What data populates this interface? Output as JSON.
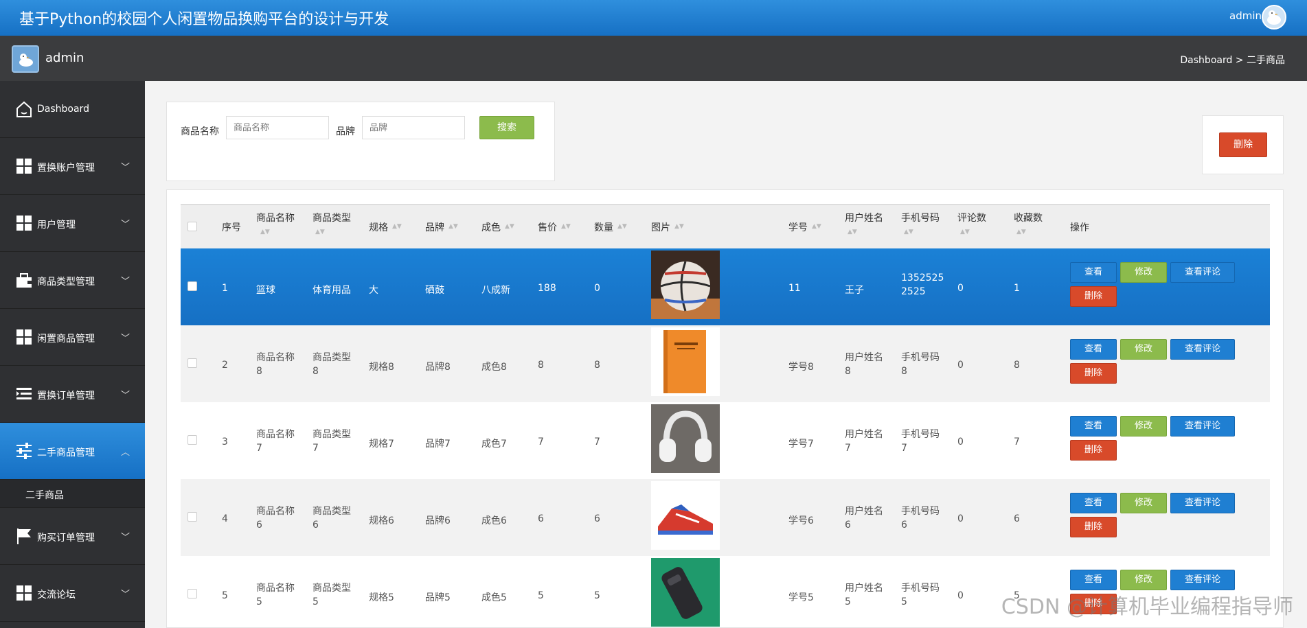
{
  "header": {
    "title": "基于Python的校园个人闲置物品换购平台的设计与开发",
    "user": "admin"
  },
  "subheader": {
    "name": "admin",
    "breadcrumb": "Dashboard > 二手商品"
  },
  "sidebar": {
    "items": [
      {
        "label": "Dashboard",
        "icon": "home-icon"
      },
      {
        "label": "置换账户管理",
        "icon": "grid-icon"
      },
      {
        "label": "用户管理",
        "icon": "grid-icon"
      },
      {
        "label": "商品类型管理",
        "icon": "briefcase-icon"
      },
      {
        "label": "闲置商品管理",
        "icon": "grid-icon"
      },
      {
        "label": "置换订单管理",
        "icon": "list-icon"
      },
      {
        "label": "二手商品管理",
        "icon": "sliders-icon"
      },
      {
        "label": "购买订单管理",
        "icon": "flag-icon"
      },
      {
        "label": "交流论坛",
        "icon": "grid-icon"
      }
    ],
    "submenu": "二手商品"
  },
  "search": {
    "name_label": "商品名称",
    "name_placeholder": "商品名称",
    "brand_label": "品牌",
    "brand_placeholder": "品牌",
    "button": "搜索"
  },
  "actions": {
    "delete": "删除"
  },
  "table": {
    "headers": [
      "序号",
      "商品名称",
      "商品类型",
      "规格",
      "品牌",
      "成色",
      "售价",
      "数量",
      "图片",
      "学号",
      "用户姓名",
      "手机号码",
      "评论数",
      "收藏数",
      "操作"
    ],
    "row_buttons": {
      "view": "查看",
      "edit": "修改",
      "reviews": "查看评论",
      "delete": "删除"
    },
    "rows": [
      {
        "no": "1",
        "name": "篮球",
        "type": "体育用品",
        "spec": "大",
        "brand": "硒鼓",
        "cond": "八成新",
        "price": "188",
        "qty": "0",
        "sid": "11",
        "uname": "王子",
        "phone1": "1352525",
        "phone2": "2525",
        "comments": "0",
        "favs": "1",
        "img": "basketball"
      },
      {
        "no": "2",
        "name": "商品名称",
        "name2": "8",
        "type": "商品类型",
        "type2": "8",
        "spec": "规格8",
        "brand": "品牌8",
        "cond": "成色8",
        "price": "8",
        "qty": "8",
        "sid": "学号8",
        "uname": "用户姓名",
        "uname2": "8",
        "phone1": "手机号码",
        "phone2": "8",
        "comments": "0",
        "favs": "8",
        "img": "book"
      },
      {
        "no": "3",
        "name": "商品名称",
        "name2": "7",
        "type": "商品类型",
        "type2": "7",
        "spec": "规格7",
        "brand": "品牌7",
        "cond": "成色7",
        "price": "7",
        "qty": "7",
        "sid": "学号7",
        "uname": "用户姓名",
        "uname2": "7",
        "phone1": "手机号码",
        "phone2": "7",
        "comments": "0",
        "favs": "7",
        "img": "headphones"
      },
      {
        "no": "4",
        "name": "商品名称",
        "name2": "6",
        "type": "商品类型",
        "type2": "6",
        "spec": "规格6",
        "brand": "品牌6",
        "cond": "成色6",
        "price": "6",
        "qty": "6",
        "sid": "学号6",
        "uname": "用户姓名",
        "uname2": "6",
        "phone1": "手机号码",
        "phone2": "6",
        "comments": "0",
        "favs": "6",
        "img": "shoe"
      },
      {
        "no": "5",
        "name": "商品名称",
        "name2": "5",
        "type": "商品类型",
        "type2": "5",
        "spec": "规格5",
        "brand": "品牌5",
        "cond": "成色5",
        "price": "5",
        "qty": "5",
        "sid": "学号5",
        "uname": "用户姓名",
        "uname2": "5",
        "phone1": "手机号码",
        "phone2": "5",
        "comments": "0",
        "favs": "5",
        "img": "device"
      }
    ]
  },
  "watermark": "CSDN @计算机毕业编程指导师"
}
